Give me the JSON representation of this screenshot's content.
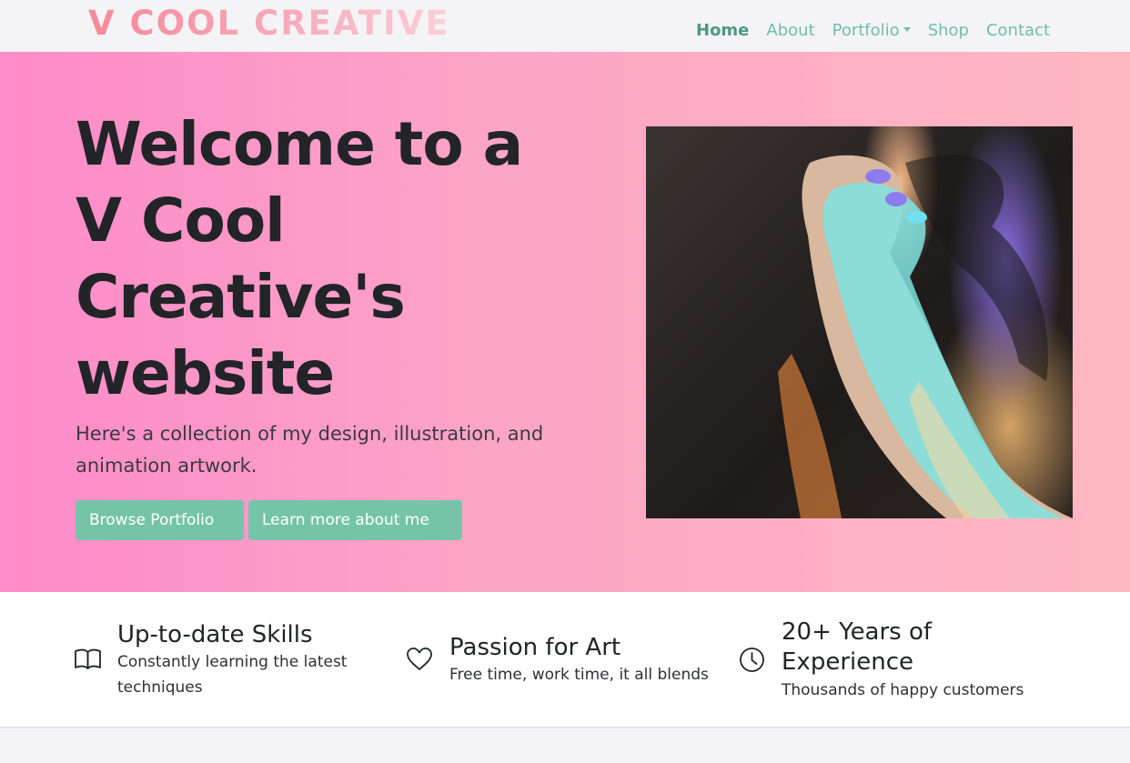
{
  "navbar": {
    "brand": "V COOL CREATIVE",
    "links": [
      {
        "label": "Home",
        "active": true
      },
      {
        "label": "About"
      },
      {
        "label": "Portfolio",
        "dropdown": true
      },
      {
        "label": "Shop"
      },
      {
        "label": "Contact"
      }
    ]
  },
  "hero": {
    "title": "Welcome to a V Cool Creative's website",
    "subtitle": "Here's a collection of my design, illustration, and animation artwork.",
    "primary_button": "Browse Portfolio",
    "secondary_button": "Learn more about me",
    "image_icon": "hands-in-light-photo"
  },
  "features": [
    {
      "icon": "book-icon",
      "title": "Up-to-date Skills",
      "text": "Constantly learning the latest techniques"
    },
    {
      "icon": "heart-icon",
      "title": "Passion for Art",
      "text": "Free time, work time, it all blends"
    },
    {
      "icon": "clock-icon",
      "title": "20+ Years of Experience",
      "text": "Thousands of happy customers"
    }
  ],
  "colors": {
    "accent": "#75c4a8",
    "nav_link": "#6fbfa6",
    "hero_gradient_start": "#fd8bc9",
    "hero_gradient_end": "#ffb8c2",
    "brand_start": "#f48a9a",
    "heading": "#222428"
  }
}
